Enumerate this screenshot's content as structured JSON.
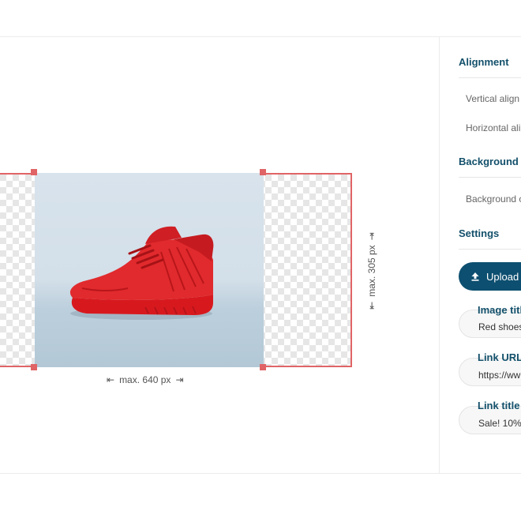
{
  "dimensions": {
    "width_label": "max. 640 px",
    "height_label": "max. 305 px"
  },
  "image": {
    "subject": "red high-top sneaker"
  },
  "panel": {
    "alignment": {
      "title": "Alignment",
      "vertical_label": "Vertical align",
      "horizontal_label": "Horizontal ali"
    },
    "background": {
      "title": "Background",
      "color_label": "Background c"
    },
    "settings": {
      "title": "Settings",
      "upload_label": "Upload",
      "image_title_label": "Image titl",
      "image_title_value": "Red shoes",
      "link_url_label": "Link URL",
      "link_url_value": "https://ww",
      "link_title_label": "Link title (",
      "link_title_value": "Sale! 10%"
    }
  },
  "colors": {
    "accent": "#0d4f70",
    "selection": "#e06466",
    "heading": "#13506b"
  }
}
